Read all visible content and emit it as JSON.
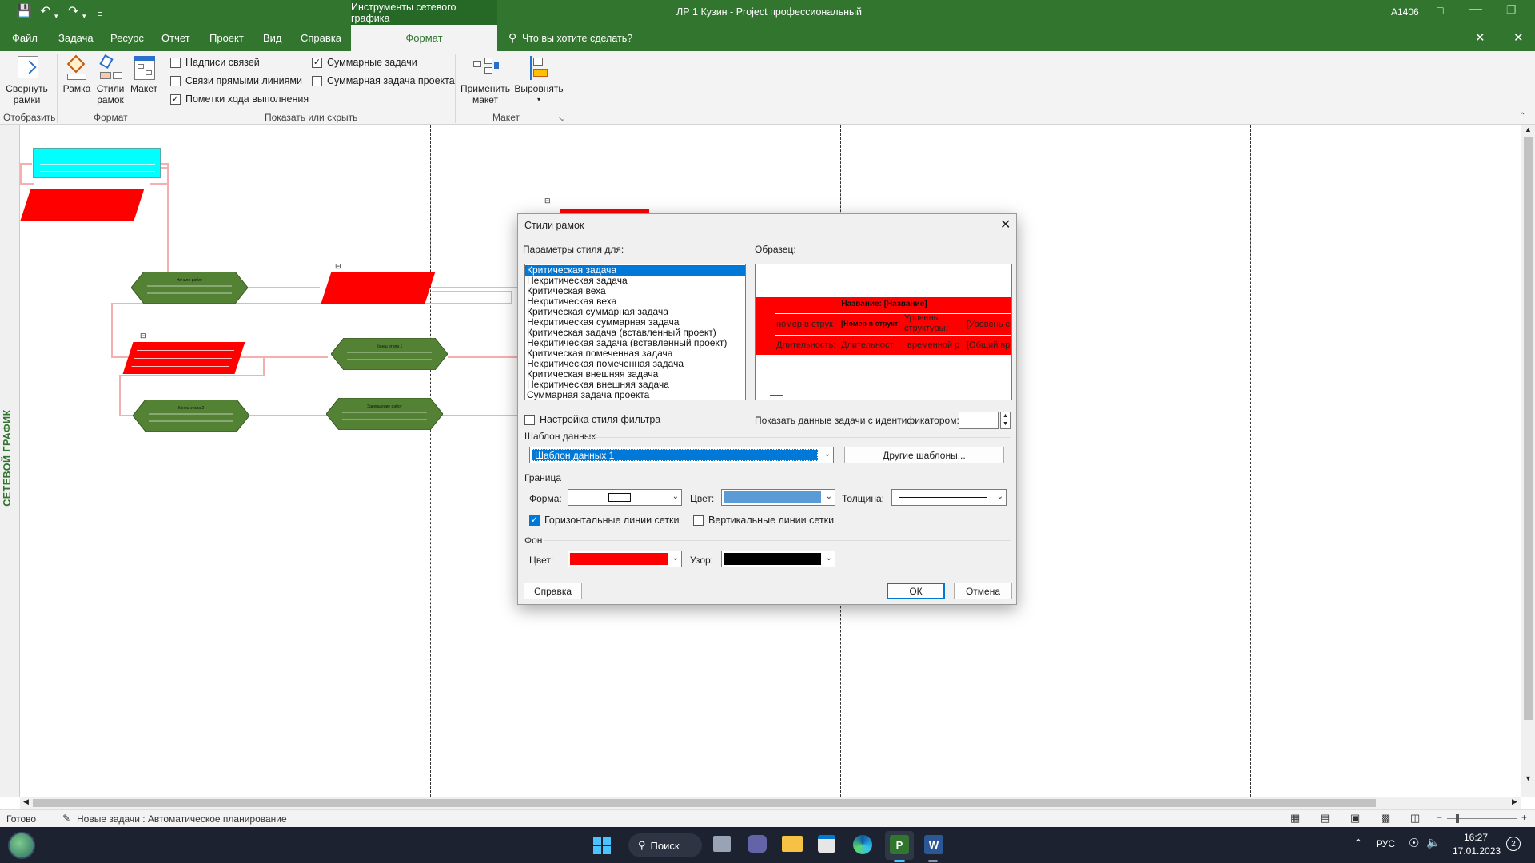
{
  "window": {
    "title": "ЛР 1 Кузин  -  Project профессиональный",
    "user": "А1406",
    "context_tab_title": "Инструменты сетевого графика"
  },
  "tabs": [
    "Файл",
    "Задача",
    "Ресурс",
    "Отчет",
    "Проект",
    "Вид",
    "Справка"
  ],
  "active_tab": "Формат",
  "tell_me": "Что вы хотите сделать?",
  "ribbon": {
    "collapse_label": "Свернуть рамки",
    "collapse_label_1": "Свернуть",
    "collapse_label_2": "рамки",
    "group_show": "Отобразить",
    "frame_label": "Рамка",
    "styles_label_1": "Стили",
    "styles_label_2": "рамок",
    "layout_label": "Макет",
    "group_format": "Формат",
    "checks": [
      {
        "label": "Надписи связей",
        "checked": false
      },
      {
        "label": "Связи прямыми линиями",
        "checked": false
      },
      {
        "label": "Пометки хода выполнения",
        "checked": true
      },
      {
        "label": "Суммарные задачи",
        "checked": true
      },
      {
        "label": "Суммарная задача проекта",
        "checked": false
      }
    ],
    "group_show_hide": "Показать или скрыть",
    "apply_layout_1": "Применить",
    "apply_layout_2": "макет",
    "align_label": "Выровнять",
    "group_layout": "Макет"
  },
  "sidebar_label": "СЕТЕВОЙ ГРАФИК",
  "network_nodes": {
    "n1": "Начало работ",
    "n2": "Этап 1 Предварительное исследование",
    "n3": "Этап 1.Разработка ТЗ",
    "n4": "Конец этапа 1",
    "n5": "Конец этапа 2",
    "n6": "Завершение работ"
  },
  "dialog": {
    "title": "Стили рамок",
    "params_label": "Параметры стиля для:",
    "sample_label": "Образец:",
    "styles_list": [
      "Критическая задача",
      "Некритическая задача",
      "Критическая веха",
      "Некритическая веха",
      "Критическая суммарная задача",
      "Некритическая суммарная задача",
      "Критическая задача (вставленный проект)",
      "Некритическая задача (вставленный проект)",
      "Критическая помеченная задача",
      "Некритическая помеченная задача",
      "Критическая внешняя задача",
      "Некритическая внешняя задача",
      "Суммарная задача проекта"
    ],
    "selected_index": 0,
    "sample": {
      "title": "Название: [Название]",
      "row1": [
        "номер в струк",
        "[Номер в структ",
        "Уровень структуры:",
        "[Уровень с"
      ],
      "row2": [
        "Длительность:",
        "Длительност",
        "временной р",
        "[Общий вр"
      ]
    },
    "filter_style_label": "Настройка стиля фильтра",
    "filter_style_checked": false,
    "show_task_data_label": "Показать данные задачи с идентификатором:",
    "data_template_group": "Шаблон данных",
    "data_template_value": "Шаблон данных 1",
    "other_templates_btn": "Другие шаблоны...",
    "border_group": "Граница",
    "shape_label": "Форма:",
    "color_label": "Цвет:",
    "thickness_label": "Толщина:",
    "border_color": "#5b9bd5",
    "horizontal_grid_label": "Горизонтальные линии сетки",
    "horizontal_grid_checked": true,
    "vertical_grid_label": "Вертикальные линии сетки",
    "vertical_grid_checked": false,
    "bg_group": "Фон",
    "bg_color_label": "Цвет:",
    "bg_color": "#ff0000",
    "pattern_label": "Узор:",
    "pattern_color": "#000000",
    "help_btn": "Справка",
    "ok_btn": "ОК",
    "cancel_btn": "Отмена"
  },
  "status": {
    "ready": "Готово",
    "new_tasks": "Новые задачи : Автоматическое планирование"
  },
  "taskbar": {
    "search": "Поиск",
    "lang": "РУС",
    "time": "16:27",
    "date": "17.01.2023",
    "notifications": "2"
  },
  "colors": {
    "accent": "#31752f",
    "critical": "#ff0000",
    "summary": "#00ffff",
    "noncritical_milestone": "#548235"
  }
}
